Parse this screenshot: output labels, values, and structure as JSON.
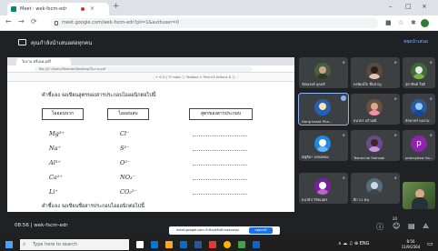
{
  "browser": {
    "tab_title": "Meet - wek-fscm-edr",
    "url": "meet.google.com/wek-fscm-edr?pli=1&authuser=0",
    "new_tab": "+",
    "win_controls": [
      "–",
      "□",
      "×"
    ],
    "nav": [
      "←",
      "→",
      "⟳"
    ]
  },
  "meet": {
    "presenting_text": "คุณกำลังนำเสนอต่อทุกคน",
    "stop_presenting": "หยุดนำเสนอ",
    "meeting_time": "08:56",
    "meeting_code": "wek-fscm-edr",
    "snackbar_text": "meet.google.com กำลังแชร์หน้าจอของคุณ",
    "snackbar_button": "หยุดแชร์",
    "participant_count": "20",
    "participants": [
      {
        "name": "ชัยณรงค์ อุดมดี",
        "type": "photo",
        "color": "#4a5d3f"
      },
      {
        "name": "พรพิมพ์ใจ ชื่นชาญ",
        "type": "photo",
        "color": "#5b4a44"
      },
      {
        "name": "สุดาทิพย์ ใจดี",
        "type": "photo",
        "color": "#3f6b3a"
      },
      {
        "name": "Dang kaset Pha...",
        "type": "photo",
        "color": "#2d5fa8",
        "active": true
      },
      {
        "name": "ธนาธร แก้วมณี",
        "type": "photo",
        "color": "#6d4f3f"
      },
      {
        "name": "ฮัยฟาคร์ พลงาม",
        "type": "photo",
        "color": "#2c5a99"
      },
      {
        "name": "ณัฐริดา พรหมทอง",
        "type": "photo",
        "color": "#1e88e5"
      },
      {
        "name": "Teerachai Somsak",
        "type": "photo",
        "color": "#6a4a8a"
      },
      {
        "name": "prakaykaw Ho...",
        "type": "letter",
        "letter": "p",
        "color": "#8e24aa"
      },
      {
        "name": "ธนาธิป วิชัยเนตร",
        "type": "photo",
        "color": "#7b1fa2"
      },
      {
        "name": "อีก 11 คน",
        "type": "photo",
        "color": "#546e7a"
      },
      {
        "name": "",
        "type": "video",
        "color": "#3e5a34"
      }
    ]
  },
  "worksheet": {
    "browser_tab": "ใบงาน ตรีเนพ.pdf",
    "url": "file:///C:/Users/Teacher/Desktop/ใบงาน.pdf",
    "pdf_toolbar": "–  +  ⟲  ⊡  |  ☷ Index  ⓘ Textbox  ⊙ Pencil  Ⅱ Actions  ⬇  ⎙  ⋮",
    "question1": "คำชี้แจง จงเขียนสูตรของสารประกอบไอออนิกต่อไปนี้",
    "col_headers": [
      "ไอออนบวก",
      "ไอออนลบ",
      "สูตรของสารประกอบ"
    ],
    "cations": [
      "Mg²⁺",
      "Na⁺",
      "Al³⁺",
      "Ca²⁺",
      "Li⁺"
    ],
    "anions": [
      "Cl⁻",
      "S²⁻",
      "O²⁻",
      "NO₃⁻",
      "CO₃²⁻"
    ],
    "question2": "คำชี้แจง จงเขียนชื่อสารประกอบไอออนิกต่อไปนี้"
  },
  "taskbar": {
    "search_placeholder": "Type here to search",
    "tray": "∧  ☁  ♫  ⊕  ENG",
    "time": "8:56",
    "date": "11/9/2564"
  }
}
